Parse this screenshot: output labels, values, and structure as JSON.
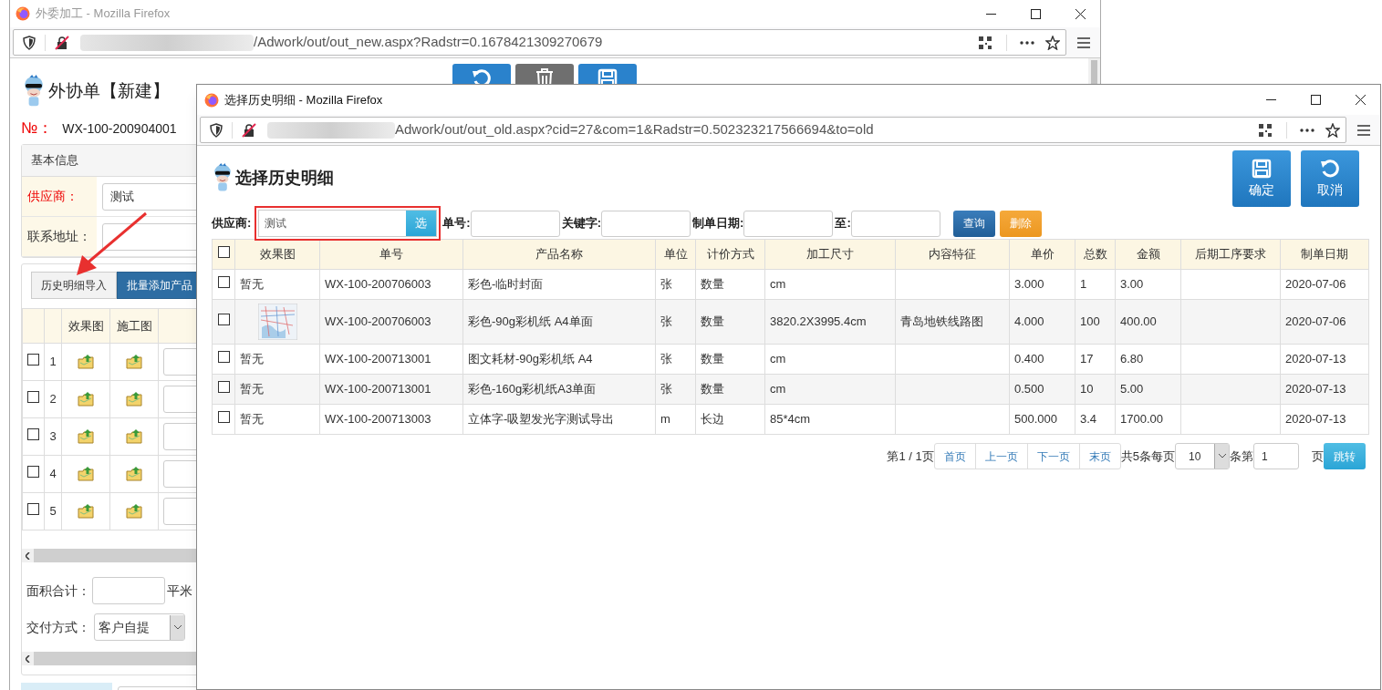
{
  "background_window": {
    "title": "外委加工 - Mozilla Firefox",
    "url": "/Adwork/out/out_new.aspx?Radstr=0.1678421309270679",
    "toolbar_buttons": [
      {
        "kind": "undo"
      },
      {
        "kind": "delete"
      },
      {
        "kind": "save"
      }
    ],
    "page_title": "外协单【新建】",
    "number_label": "№：",
    "number": "WX-100-200904001",
    "basic_info": {
      "heading": "基本信息",
      "fields": [
        {
          "label": "供应商：",
          "value": "测试",
          "required": true
        },
        {
          "label": "联系地址：",
          "required": false
        }
      ]
    },
    "detail_buttons": [
      {
        "label": "历史明细导入",
        "kind": "default"
      },
      {
        "label": "批量添加产品",
        "kind": "primary"
      }
    ],
    "detail_columns": [
      "效果图",
      "施工图"
    ],
    "detail_rows": [
      {
        "number": "1",
        "checked": false
      },
      {
        "number": "2",
        "checked": false
      },
      {
        "number": "3",
        "checked": false
      },
      {
        "number": "4",
        "checked": false
      },
      {
        "number": "5",
        "checked": false
      }
    ],
    "area_total": {
      "label": "面积合计：",
      "unit": "平米"
    },
    "delivery": {
      "label": "交付方式：",
      "value": "客户自提"
    }
  },
  "dialog_window": {
    "title": "选择历史明细 - Mozilla Firefox",
    "url": "Adwork/out/out_old.aspx?cid=27&com=1&Radstr=0.502323217566694&to=old",
    "heading": "选择历史明细",
    "actions": [
      {
        "label": "确定",
        "kind": "save"
      },
      {
        "label": "取消",
        "kind": "undo"
      }
    ],
    "filters": [
      {
        "label": "供应商:",
        "value": "测试",
        "button": "选",
        "highlighted": true
      },
      {
        "label": "单号:",
        "highlighted": false
      },
      {
        "label": "关键字:",
        "highlighted": false
      },
      {
        "label": "制单日期:",
        "highlighted": false
      },
      {
        "label": "至:",
        "highlighted": false
      }
    ],
    "filter_buttons": [
      {
        "label": "查询",
        "kind": "primary"
      },
      {
        "label": "删除",
        "kind": "warning"
      }
    ],
    "columns": [
      "效果图",
      "单号",
      "产品名称",
      "单位",
      "计价方式",
      "加工尺寸",
      "内容特征",
      "单价",
      "总数",
      "金额",
      "后期工序要求",
      "制单日期"
    ],
    "all_checked": false,
    "rows": [
      {
        "checked": false,
        "thumbnail": false,
        "cells": [
          "暂无",
          "WX-100-200706003",
          "彩色-临时封面",
          "张",
          "数量",
          "cm",
          "",
          "3.000",
          "1",
          "3.00",
          "",
          "2020-07-06"
        ]
      },
      {
        "checked": false,
        "thumbnail": true,
        "cells": [
          "",
          "WX-100-200706003",
          "彩色-90g彩机纸 A4单面",
          "张",
          "数量",
          "3820.2X3995.4cm",
          "青岛地铁线路图",
          "4.000",
          "100",
          "400.00",
          "",
          "2020-07-06"
        ]
      },
      {
        "checked": false,
        "thumbnail": false,
        "cells": [
          "暂无",
          "WX-100-200713001",
          "图文耗材-90g彩机纸 A4",
          "张",
          "数量",
          "cm",
          "",
          "0.400",
          "17",
          "6.80",
          "",
          "2020-07-13"
        ]
      },
      {
        "checked": false,
        "thumbnail": false,
        "cells": [
          "暂无",
          "WX-100-200713001",
          "彩色-160g彩机纸A3单面",
          "张",
          "数量",
          "cm",
          "",
          "0.500",
          "10",
          "5.00",
          "",
          "2020-07-13"
        ]
      },
      {
        "checked": false,
        "thumbnail": false,
        "cells": [
          "暂无",
          "WX-100-200713003",
          "立体字-吸塑发光字测试导出",
          "m",
          "长边",
          "85*4cm",
          "",
          "500.000",
          "3.4",
          "1700.00",
          "",
          "2020-07-13"
        ]
      }
    ],
    "pagination": {
      "page_info": "第1 / 1页",
      "links": [
        "首页",
        "上一页",
        "下一页",
        "末页"
      ],
      "total_text": "共5条每页",
      "page_size": "10",
      "goto_prefix": "条第",
      "goto_page": "1",
      "goto_suffix": "页",
      "goto_button": "跳转"
    }
  }
}
